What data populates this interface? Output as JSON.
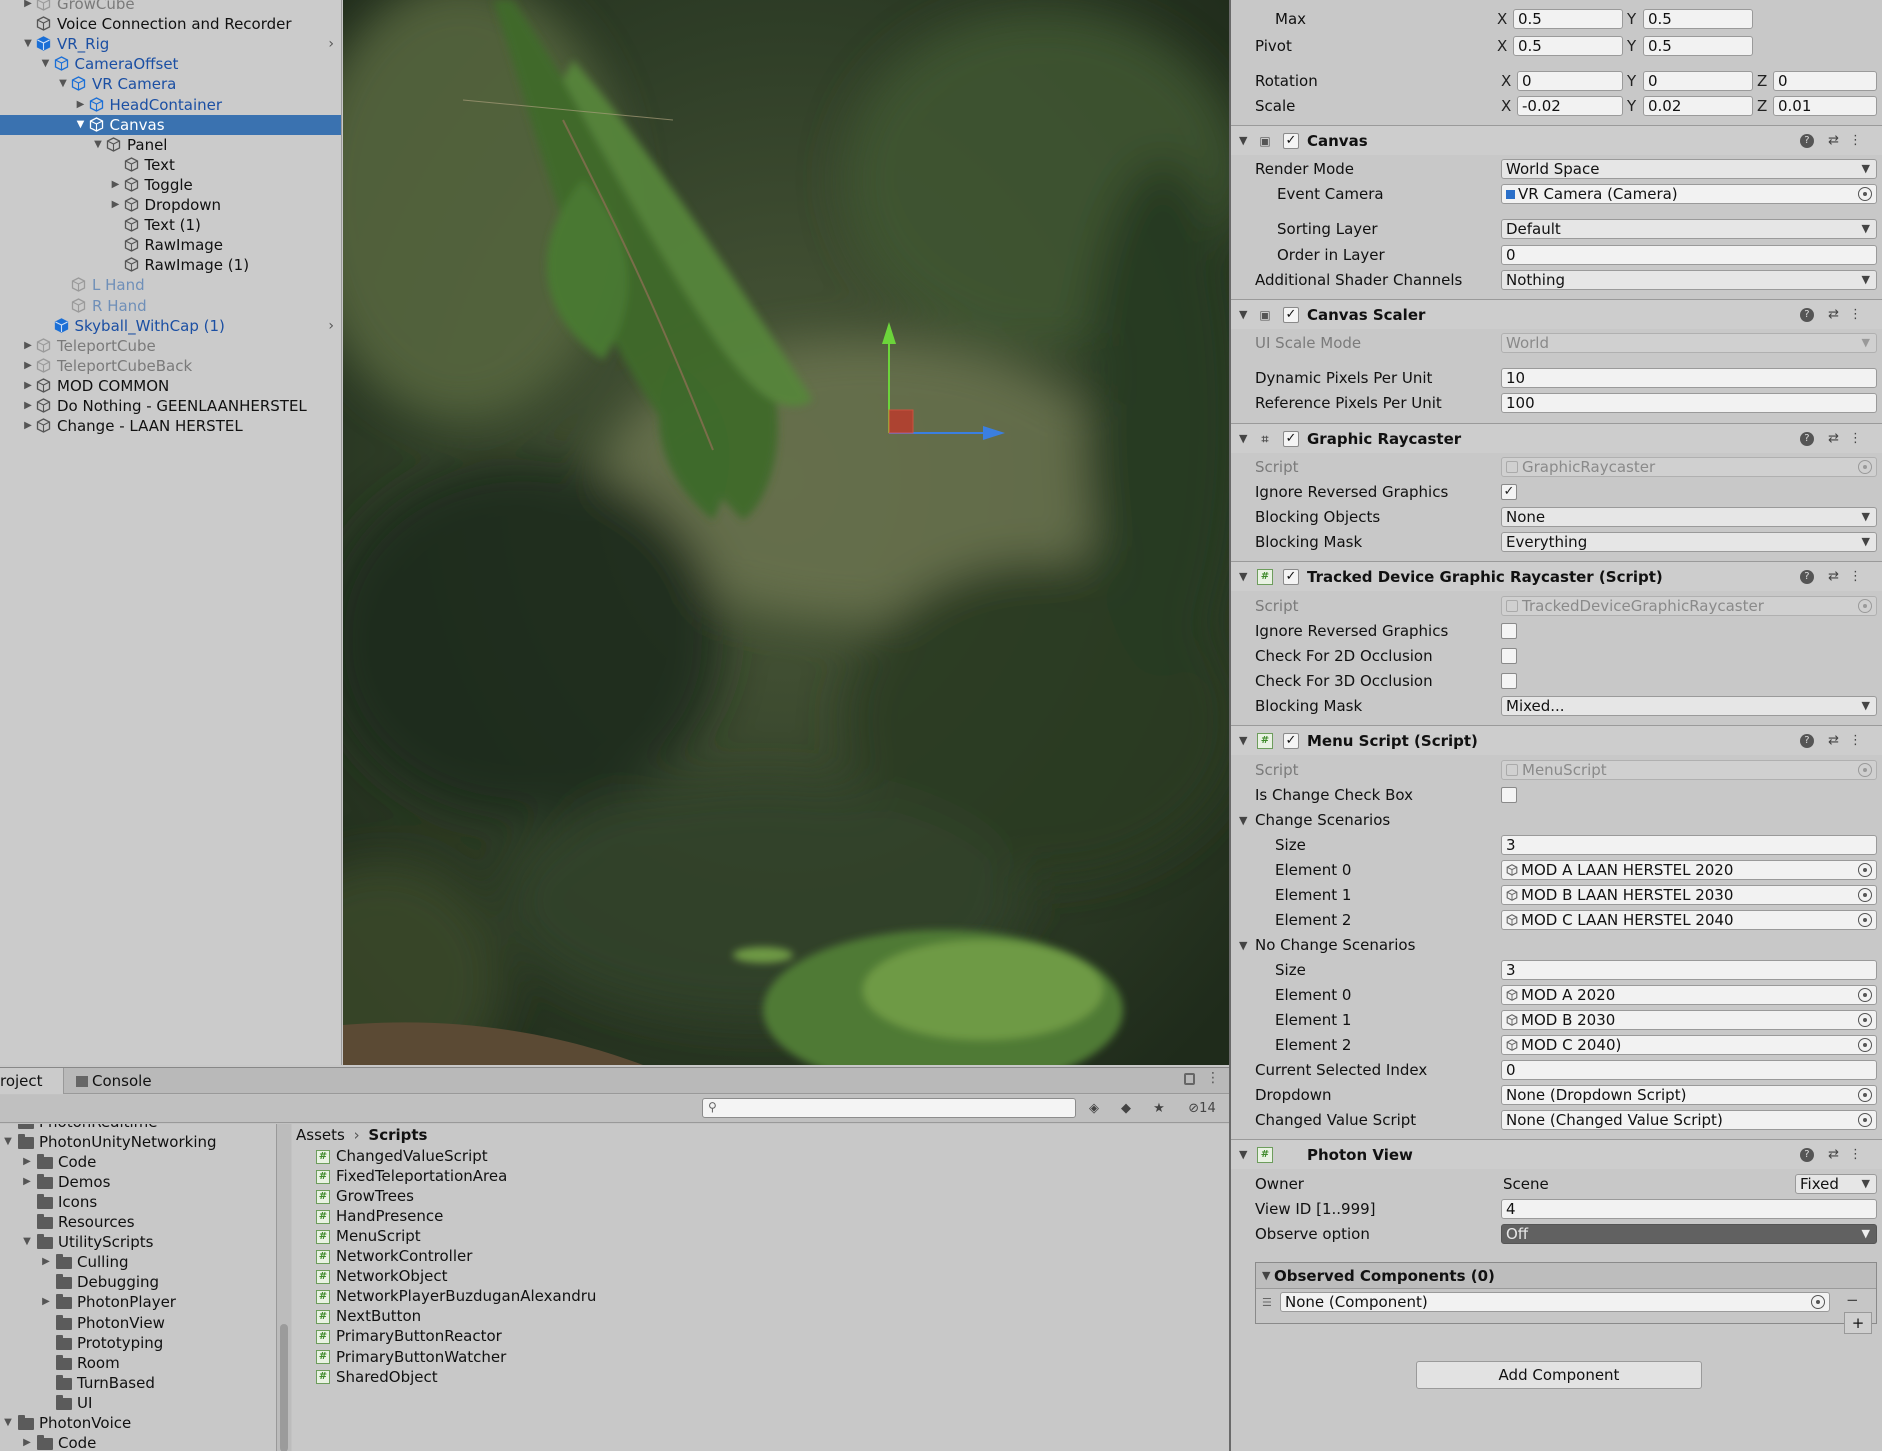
{
  "hierarchy": {
    "items": [
      {
        "label": "GrowCube",
        "depth": 0,
        "arrow": "▶",
        "style": "gray"
      },
      {
        "label": "Voice Connection and Recorder",
        "depth": 0,
        "arrow": "",
        "style": ""
      },
      {
        "label": "VR_Rig",
        "depth": 0,
        "arrow": "▼",
        "style": "blue",
        "more": "›"
      },
      {
        "label": "CameraOffset",
        "depth": 1,
        "arrow": "▼",
        "style": "blue"
      },
      {
        "label": "VR Camera",
        "depth": 2,
        "arrow": "▼",
        "style": "blue"
      },
      {
        "label": "HeadContainer",
        "depth": 3,
        "arrow": "▶",
        "style": "blue"
      },
      {
        "label": "Canvas",
        "depth": 3,
        "arrow": "▼",
        "style": "sel"
      },
      {
        "label": "Panel",
        "depth": 4,
        "arrow": "▼",
        "style": ""
      },
      {
        "label": "Text",
        "depth": 5,
        "arrow": "",
        "style": ""
      },
      {
        "label": "Toggle",
        "depth": 5,
        "arrow": "▶",
        "style": ""
      },
      {
        "label": "Dropdown",
        "depth": 5,
        "arrow": "▶",
        "style": ""
      },
      {
        "label": "Text (1)",
        "depth": 5,
        "arrow": "",
        "style": ""
      },
      {
        "label": "RawImage",
        "depth": 5,
        "arrow": "",
        "style": ""
      },
      {
        "label": "RawImage (1)",
        "depth": 5,
        "arrow": "",
        "style": ""
      },
      {
        "label": "L Hand",
        "depth": 2,
        "arrow": "",
        "style": "ltblue"
      },
      {
        "label": "R Hand",
        "depth": 2,
        "arrow": "",
        "style": "ltblue"
      },
      {
        "label": "Skyball_WithCap (1)",
        "depth": 1,
        "arrow": "",
        "style": "blue",
        "more": "›"
      },
      {
        "label": "TeleportCube",
        "depth": 0,
        "arrow": "▶",
        "style": "gray"
      },
      {
        "label": "TeleportCubeBack",
        "depth": 0,
        "arrow": "▶",
        "style": "gray"
      },
      {
        "label": "MOD COMMON",
        "depth": 0,
        "arrow": "▶",
        "style": ""
      },
      {
        "label": "Do Nothing - GEENLAANHERSTEL",
        "depth": 0,
        "arrow": "▶",
        "style": ""
      },
      {
        "label": "Change - LAAN HERSTEL",
        "depth": 0,
        "arrow": "▶",
        "style": ""
      }
    ]
  },
  "project": {
    "tabs": {
      "project": "roject",
      "console": "Console"
    },
    "hidden_count": "14",
    "tree": [
      {
        "label": "PhotonRealtime",
        "depth": 0,
        "arrow": "",
        "partial": true
      },
      {
        "label": "PhotonUnityNetworking",
        "depth": 0,
        "arrow": "▼"
      },
      {
        "label": "Code",
        "depth": 1,
        "arrow": "▶"
      },
      {
        "label": "Demos",
        "depth": 1,
        "arrow": "▶"
      },
      {
        "label": "Icons",
        "depth": 1,
        "arrow": ""
      },
      {
        "label": "Resources",
        "depth": 1,
        "arrow": ""
      },
      {
        "label": "UtilityScripts",
        "depth": 1,
        "arrow": "▼"
      },
      {
        "label": "Culling",
        "depth": 2,
        "arrow": "▶"
      },
      {
        "label": "Debugging",
        "depth": 2,
        "arrow": ""
      },
      {
        "label": "PhotonPlayer",
        "depth": 2,
        "arrow": "▶"
      },
      {
        "label": "PhotonView",
        "depth": 2,
        "arrow": ""
      },
      {
        "label": "Prototyping",
        "depth": 2,
        "arrow": ""
      },
      {
        "label": "Room",
        "depth": 2,
        "arrow": ""
      },
      {
        "label": "TurnBased",
        "depth": 2,
        "arrow": ""
      },
      {
        "label": "UI",
        "depth": 2,
        "arrow": ""
      },
      {
        "label": "PhotonVoice",
        "depth": 0,
        "arrow": "▼"
      },
      {
        "label": "Code",
        "depth": 1,
        "arrow": "▶"
      }
    ],
    "breadcrumb": {
      "root": "Assets",
      "sep": "›",
      "current": "Scripts"
    },
    "files": [
      "ChangedValueScript",
      "FixedTeleportationArea",
      "GrowTrees",
      "HandPresence",
      "MenuScript",
      "NetworkController",
      "NetworkObject",
      "NetworkPlayerBuzduganAlexandru",
      "NextButton",
      "PrimaryButtonReactor",
      "PrimaryButtonWatcher",
      "SharedObject"
    ]
  },
  "inspector": {
    "rect": {
      "max_label": "Max",
      "max_x": "0.5",
      "max_y": "0.5",
      "pivot_label": "Pivot",
      "pivot_x": "0.5",
      "pivot_y": "0.5",
      "rotation_label": "Rotation",
      "rot_x": "0",
      "rot_y": "0",
      "rot_z": "0",
      "scale_label": "Scale",
      "scale_x": "-0.02",
      "scale_y": "0.02",
      "scale_z": "0.01",
      "x": "X",
      "y": "Y",
      "z": "Z"
    },
    "canvas": {
      "title": "Canvas",
      "render_mode_label": "Render Mode",
      "render_mode": "World Space",
      "event_camera_label": "Event Camera",
      "event_camera": "VR Camera (Camera)",
      "sorting_layer_label": "Sorting Layer",
      "sorting_layer": "Default",
      "order_label": "Order in Layer",
      "order": "0",
      "shader_label": "Additional Shader Channels",
      "shader": "Nothing"
    },
    "scaler": {
      "title": "Canvas Scaler",
      "ui_scale_label": "UI Scale Mode",
      "ui_scale": "World",
      "dyn_label": "Dynamic Pixels Per Unit",
      "dyn": "10",
      "ref_label": "Reference Pixels Per Unit",
      "ref": "100"
    },
    "raycaster": {
      "title": "Graphic Raycaster",
      "script_label": "Script",
      "script": "GraphicRaycaster",
      "ignore_label": "Ignore Reversed Graphics",
      "ignore": true,
      "blocking_label": "Blocking Objects",
      "blocking": "None",
      "mask_label": "Blocking Mask",
      "mask": "Everything"
    },
    "tracked": {
      "title": "Tracked Device Graphic Raycaster (Script)",
      "script_label": "Script",
      "script": "TrackedDeviceGraphicRaycaster",
      "ignore_label": "Ignore Reversed Graphics",
      "ignore": false,
      "check2d_label": "Check For 2D Occlusion",
      "check2d": false,
      "check3d_label": "Check For 3D Occlusion",
      "check3d": false,
      "mask_label": "Blocking Mask",
      "mask": "Mixed..."
    },
    "menu": {
      "title": "Menu Script (Script)",
      "script_label": "Script",
      "script": "MenuScript",
      "is_change_label": "Is Change Check Box",
      "is_change": false,
      "change_label": "Change Scenarios",
      "size_label": "Size",
      "change_size": "3",
      "change_elements": [
        {
          "label": "Element 0",
          "value": "MOD A LAAN HERSTEL 2020"
        },
        {
          "label": "Element 1",
          "value": "MOD B LAAN HERSTEL 2030"
        },
        {
          "label": "Element 2",
          "value": "MOD C LAAN HERSTEL 2040"
        }
      ],
      "nochange_label": "No Change Scenarios",
      "nochange_size": "3",
      "nochange_elements": [
        {
          "label": "Element 0",
          "value": "MOD A 2020"
        },
        {
          "label": "Element 1",
          "value": "MOD B 2030"
        },
        {
          "label": "Element 2",
          "value": "MOD C 2040)"
        }
      ],
      "current_label": "Current Selected Index",
      "current": "0",
      "dropdown_label": "Dropdown",
      "dropdown": "None (Dropdown Script)",
      "changed_label": "Changed Value Script",
      "changed": "None (Changed Value Script)"
    },
    "photon": {
      "title": "Photon View",
      "owner_label": "Owner",
      "owner": "Scene",
      "owner_mode": "Fixed",
      "viewid_label": "View ID [1..999]",
      "viewid": "4",
      "observe_label": "Observe option",
      "observe": "Off",
      "observed_title": "Observed Components (0)",
      "observed_item": "None (Component)"
    },
    "add_component": "Add Component"
  }
}
